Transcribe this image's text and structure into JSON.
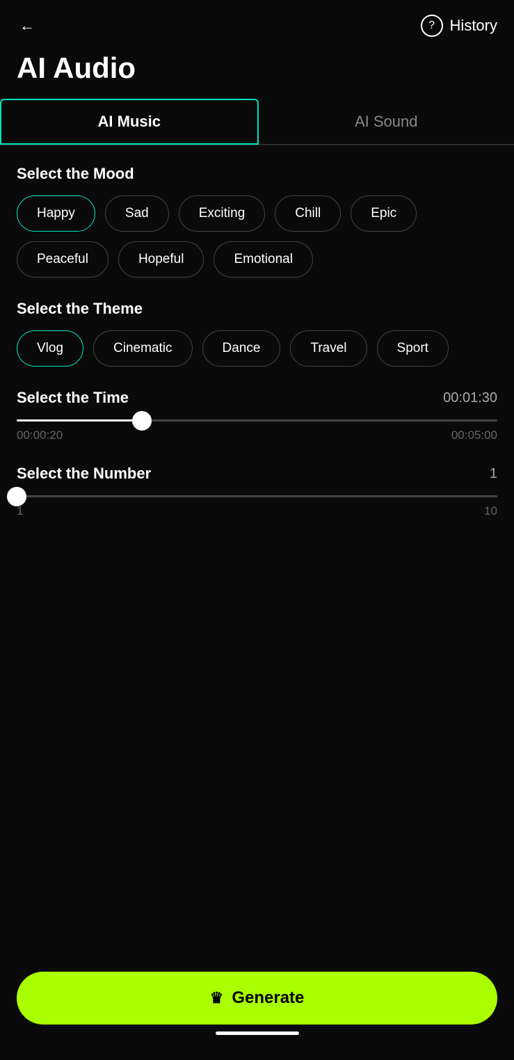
{
  "header": {
    "back_label": "←",
    "help_icon": "?",
    "history_label": "History"
  },
  "page": {
    "title": "AI Audio"
  },
  "tabs": [
    {
      "id": "ai-music",
      "label": "AI Music",
      "active": true
    },
    {
      "id": "ai-sound",
      "label": "AI Sound",
      "active": false
    }
  ],
  "mood": {
    "section_title": "Select the Mood",
    "options": [
      {
        "id": "happy",
        "label": "Happy",
        "selected": true
      },
      {
        "id": "sad",
        "label": "Sad",
        "selected": false
      },
      {
        "id": "exciting",
        "label": "Exciting",
        "selected": false
      },
      {
        "id": "chill",
        "label": "Chill",
        "selected": false
      },
      {
        "id": "epic",
        "label": "Epic",
        "selected": false
      },
      {
        "id": "peaceful",
        "label": "Peaceful",
        "selected": false
      },
      {
        "id": "hopeful",
        "label": "Hopeful",
        "selected": false
      },
      {
        "id": "emotional",
        "label": "Emotional",
        "selected": false
      }
    ]
  },
  "theme": {
    "section_title": "Select the Theme",
    "options": [
      {
        "id": "vlog",
        "label": "Vlog",
        "selected": true
      },
      {
        "id": "cinematic",
        "label": "Cinematic",
        "selected": false
      },
      {
        "id": "dance",
        "label": "Dance",
        "selected": false
      },
      {
        "id": "travel",
        "label": "Travel",
        "selected": false
      },
      {
        "id": "sport",
        "label": "Sport",
        "selected": false
      }
    ]
  },
  "time": {
    "section_title": "Select the Time",
    "current_value": "00:01:30",
    "min_label": "00:00:20",
    "max_label": "00:05:00",
    "slider_percent": 26
  },
  "number": {
    "section_title": "Select the Number",
    "current_value": "1",
    "min_label": "1",
    "max_label": "10",
    "slider_percent": 0
  },
  "generate": {
    "icon": "♛",
    "label": "Generate"
  }
}
